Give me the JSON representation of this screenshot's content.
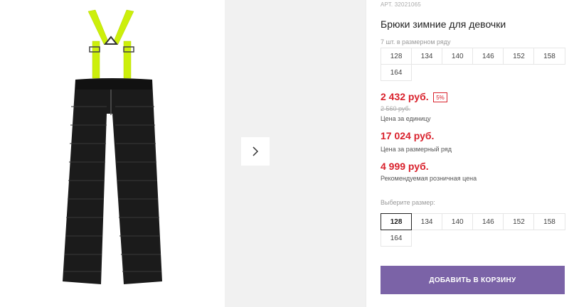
{
  "product": {
    "article": "АРТ. 32021065",
    "title": "Брюки зимние для девочки",
    "set_note": "7 шт. в размерном ряду"
  },
  "size_row_sizes": [
    "128",
    "134",
    "140",
    "146",
    "152",
    "158",
    "164"
  ],
  "pricing": {
    "unit_price": "2 432 руб.",
    "discount": "5%",
    "old_price": "2 560 руб.",
    "unit_caption": "Цена за единицу",
    "set_price": "17 024 руб.",
    "set_caption": "Цена за размерный ряд",
    "rrp_price": "4 999 руб.",
    "rrp_caption": "Рекомендуемая розничная цена"
  },
  "size_picker": {
    "label": "Выберите размер:",
    "sizes": [
      "128",
      "134",
      "140",
      "146",
      "152",
      "158",
      "164"
    ],
    "selected": "128"
  },
  "cart": {
    "button_label": "ДОБАВИТЬ В КОРЗИНУ"
  },
  "colors": {
    "accent_purple": "#7b63a7",
    "price_red": "#d9212c",
    "suspender_yellow": "#ccef0b",
    "pants_black": "#1b1b1b"
  },
  "icons": {
    "next": "chevron-right-icon"
  }
}
